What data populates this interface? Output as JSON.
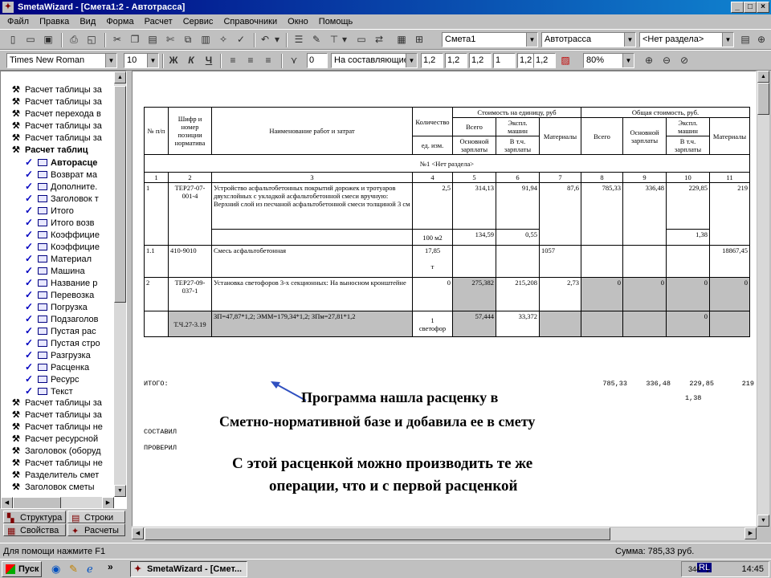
{
  "window": {
    "title": "SmetaWizard - [Смета1:2 - Автотрасса]"
  },
  "menu": [
    "Файл",
    "Правка",
    "Вид",
    "Форма",
    "Расчет",
    "Сервис",
    "Справочники",
    "Окно",
    "Помощь"
  ],
  "toolbar1": {
    "estimate_combo": "Смета1",
    "object_combo": "Автотрасса",
    "section_combo": "<Нет раздела>"
  },
  "toolbar2": {
    "font": "Times New Roman",
    "size": "10",
    "bold": "Ж",
    "italic": "К",
    "underline": "Ч",
    "value_box": "0",
    "components_combo": "На составляющие",
    "coefs": [
      "1,2",
      "1,2",
      "1,2",
      "1",
      "1,2",
      "1,2"
    ],
    "zoom": "80%"
  },
  "tree": {
    "items": [
      {
        "label": "Расчет таблицы за",
        "type": "calc",
        "bold": false
      },
      {
        "label": "Расчет таблицы за",
        "type": "calc",
        "bold": false
      },
      {
        "label": "Расчет перехода в",
        "type": "calc",
        "bold": false
      },
      {
        "label": "Расчет таблицы за",
        "type": "calc",
        "bold": false
      },
      {
        "label": "Расчет таблицы за",
        "type": "calc",
        "bold": false
      },
      {
        "label": "Расчет таблиц",
        "type": "calc-open",
        "bold": true
      },
      {
        "label": "Авторасце",
        "type": "check",
        "bold": true
      },
      {
        "label": "Возврат ма",
        "type": "check",
        "bold": false
      },
      {
        "label": "Дополните.",
        "type": "check",
        "bold": false
      },
      {
        "label": "Заголовок т",
        "type": "check",
        "bold": false
      },
      {
        "label": "Итого",
        "type": "check",
        "bold": false
      },
      {
        "label": "Итого возв",
        "type": "check",
        "bold": false
      },
      {
        "label": "Коэффицие",
        "type": "check",
        "bold": false
      },
      {
        "label": "Коэффицие",
        "type": "check",
        "bold": false
      },
      {
        "label": "Материал",
        "type": "check",
        "bold": false
      },
      {
        "label": "Машина",
        "type": "check",
        "bold": false
      },
      {
        "label": "Название р",
        "type": "check",
        "bold": false
      },
      {
        "label": "Перевозка",
        "type": "check",
        "bold": false
      },
      {
        "label": "Погрузка",
        "type": "check",
        "bold": false
      },
      {
        "label": "Подзаголов",
        "type": "check",
        "bold": false
      },
      {
        "label": "Пустая рас",
        "type": "check",
        "bold": false
      },
      {
        "label": "Пустая стро",
        "type": "check",
        "bold": false
      },
      {
        "label": "Разгрузка",
        "type": "check",
        "bold": false
      },
      {
        "label": "Расценка",
        "type": "check",
        "bold": false
      },
      {
        "label": "Ресурс",
        "type": "check",
        "bold": false
      },
      {
        "label": "Текст",
        "type": "check",
        "bold": false
      },
      {
        "label": "Расчет таблицы за",
        "type": "calc",
        "bold": false
      },
      {
        "label": "Расчет таблицы за",
        "type": "calc",
        "bold": false
      },
      {
        "label": "Расчет таблицы не",
        "type": "calc",
        "bold": false
      },
      {
        "label": "Расчет ресурсной",
        "type": "calc",
        "bold": false
      },
      {
        "label": "Заголовок (оборуд",
        "type": "calc",
        "bold": false
      },
      {
        "label": "Расчет таблицы не",
        "type": "calc",
        "bold": false
      },
      {
        "label": "Разделитель смет",
        "type": "calc",
        "bold": false
      },
      {
        "label": "Заголовок сметы",
        "type": "calc",
        "bold": false
      }
    ]
  },
  "panel_tabs": {
    "structure": "Структура",
    "rows": "Строки",
    "properties": "Свойства",
    "calcs": "Расчеты"
  },
  "estimate": {
    "header": {
      "num": "№ п/п",
      "code": "Шифр и номер позиции норматива",
      "name": "Наименование работ и затрат",
      "qty": "Количество",
      "unit_cost": "Стоимость на единицу, руб",
      "total_cost": "Общая стоимость, руб.",
      "total": "Всего",
      "machines": "Экспл. машин",
      "materials": "Материалы",
      "unit": "ед. изм.",
      "wages": "Основной зарплаты",
      "incl_wages": "В т.ч. зарплаты"
    },
    "colnums": [
      "1",
      "2",
      "3",
      "4",
      "5",
      "6",
      "7",
      "8",
      "9",
      "10",
      "11"
    ],
    "section": "№1 <Нет раздела>",
    "rows": [
      {
        "n": "1",
        "code": "ТЕР27-07-001-4",
        "name": "Устройство асфальтобетонных покрытий дорожек и тротуаров двухслойных с укладкой асфальтобетонной смеси вручную: Верхний слой из песчаной асфальтобетонной смеси толщиной 3 см",
        "qty": "2,5",
        "unit": "100 м2",
        "c5": "314,13",
        "c5b": "134,59",
        "c6": "91,94",
        "c6b": "0,55",
        "c7": "87,6",
        "c8": "785,33",
        "c9": "336,48",
        "c10": "229,85",
        "c10b": "1,38",
        "c11": "219"
      },
      {
        "n": "1.1",
        "code": "410-9010",
        "name": "Смесь асфальтобетонная",
        "qty": "17,85",
        "unit": "т",
        "c7": "1057",
        "c11": "18867,45"
      },
      {
        "n": "2",
        "code": "ТЕР27-09-037-1",
        "name": "Установка светофоров 3-х секционных: На выносном кронштейне",
        "qty": "0",
        "c5": "275,382",
        "c6": "215,208",
        "c7": "2,73",
        "c8": "0",
        "c9": "0",
        "c10": "0",
        "c11": "0"
      },
      {
        "code": "Т.Ч.27-3.19",
        "name": "ЗП=47,87*1,2; ЭММ=179,34*1,2; ЗПм=27,81*1,2",
        "qty": "1",
        "unit": "светофор",
        "c5": "57,444",
        "c6": "33,372",
        "c10": "0"
      }
    ],
    "itogo_label": "ИТОГО:",
    "itogo": {
      "c8": "785,33",
      "c9": "336,48",
      "c10": "229,85",
      "c11": "219",
      "c10b": "1,38"
    },
    "sostavil": "СОСТАВИЛ",
    "proveril": "ПРОВЕРИЛ"
  },
  "annotations": {
    "line1": "Программа нашла расценку в",
    "line2": "Сметно-нормативной базе и добавила ее в смету",
    "line3": "С этой расценкой можно производить те же",
    "line4": "операции, что и с первой расценкой"
  },
  "status": {
    "help": "Для помощи нажмите F1",
    "sum": "Сумма: 785,33 руб."
  },
  "taskbar": {
    "start": "Пуск",
    "task": "SmetaWizard - [Смет...",
    "lang": "RL",
    "clock": "14:45",
    "tray_num": "344"
  },
  "colors": {
    "title_start": "#000080",
    "title_end": "#1084d0",
    "arrow": "#3050c0"
  }
}
